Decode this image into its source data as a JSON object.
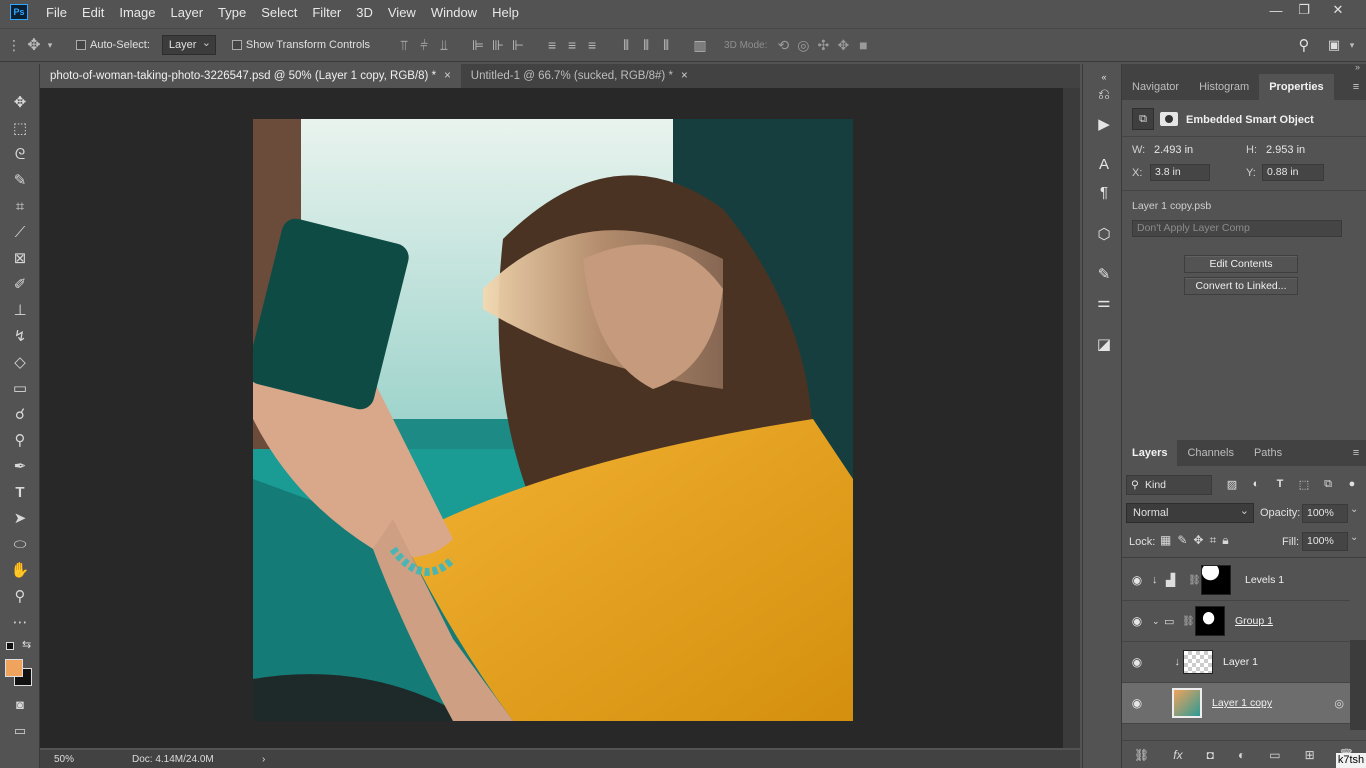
{
  "app": {
    "logo_text": "Ps"
  },
  "menu": [
    "File",
    "Edit",
    "Image",
    "Layer",
    "Type",
    "Select",
    "Filter",
    "3D",
    "View",
    "Window",
    "Help"
  ],
  "window_controls": {
    "minimize": "—",
    "restore": "❐",
    "close": "✕"
  },
  "options": {
    "auto_select_label": "Auto-Select:",
    "auto_select_target": "Layer",
    "transform_label": "Show Transform Controls",
    "mode_3d_label": "3D Mode:"
  },
  "tabs": [
    {
      "label": "photo-of-woman-taking-photo-3226547.psd @ 50% (Layer 1 copy, RGB/8) *",
      "close": "×"
    },
    {
      "label": "Untitled-1 @ 66.7% (sucked, RGB/8#) *",
      "close": "×"
    }
  ],
  "status": {
    "zoom": "50%",
    "doc": "Doc: 4.14M/24.0M",
    "arrow": "›"
  },
  "properties": {
    "tabs": [
      "Navigator",
      "Histogram",
      "Properties"
    ],
    "menu": "≡",
    "object_type": "Embedded Smart Object",
    "w_label": "W:",
    "w_value": "2.493 in",
    "h_label": "H:",
    "h_value": "2.953 in",
    "x_label": "X:",
    "x_value": "3.8 in",
    "y_label": "Y:",
    "y_value": "0.88 in",
    "filename": "Layer 1 copy.psb",
    "layer_comp": "Don't Apply Layer Comp",
    "edit_contents": "Edit Contents",
    "convert_linked": "Convert to Linked..."
  },
  "layers_panel": {
    "tabs": [
      "Layers",
      "Channels",
      "Paths"
    ],
    "menu": "≡",
    "kind_label": "Kind",
    "blend_mode": "Normal",
    "opacity_label": "Opacity:",
    "opacity_value": "100%",
    "lock_label": "Lock:",
    "fill_label": "Fill:",
    "fill_value": "100%",
    "layers": [
      {
        "name": "Levels 1"
      },
      {
        "name": "Group 1"
      },
      {
        "name": "Layer 1"
      },
      {
        "name": "Layer 1 copy"
      }
    ]
  },
  "watermark": "k7tsh"
}
